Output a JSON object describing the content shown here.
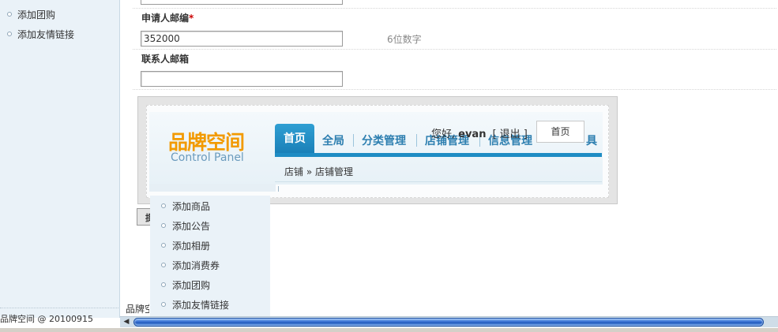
{
  "sidebar": {
    "items": [
      {
        "label": "添加团购"
      },
      {
        "label": "添加友情链接"
      }
    ],
    "footer": "品牌空间 @ 20100915"
  },
  "form": {
    "postcode_label": "申请人邮编",
    "required_mark": "*",
    "postcode_value": "352000",
    "postcode_hint": "6位数字",
    "email_label": "联系人邮箱",
    "email_value": ""
  },
  "control_panel": {
    "logo_cn": "品牌空间",
    "logo_en": "Control Panel",
    "greeting": "您好,",
    "username": "evan",
    "logout": "[ 退出 ]",
    "home_popup": "首页",
    "nav": [
      {
        "label": "首页",
        "active": true
      },
      {
        "label": "全局"
      },
      {
        "label": "分类管理"
      },
      {
        "label": "店铺管理"
      },
      {
        "label": "信息管理"
      },
      {
        "label": "具"
      }
    ],
    "breadcrumb": "店铺 » 店铺管理"
  },
  "dropdown": {
    "items": [
      {
        "label": "添加商品"
      },
      {
        "label": "添加公告"
      },
      {
        "label": "添加相册"
      },
      {
        "label": "添加消费券"
      },
      {
        "label": "添加团购"
      },
      {
        "label": "添加友情链接"
      }
    ]
  },
  "main_footer": "品牌空",
  "partial_button": "提",
  "scrollbar": {
    "left_arrow": "◀"
  },
  "colors": {
    "accent": "#1f8cc4",
    "logo": "#f29a00",
    "required": "#cc0000"
  }
}
